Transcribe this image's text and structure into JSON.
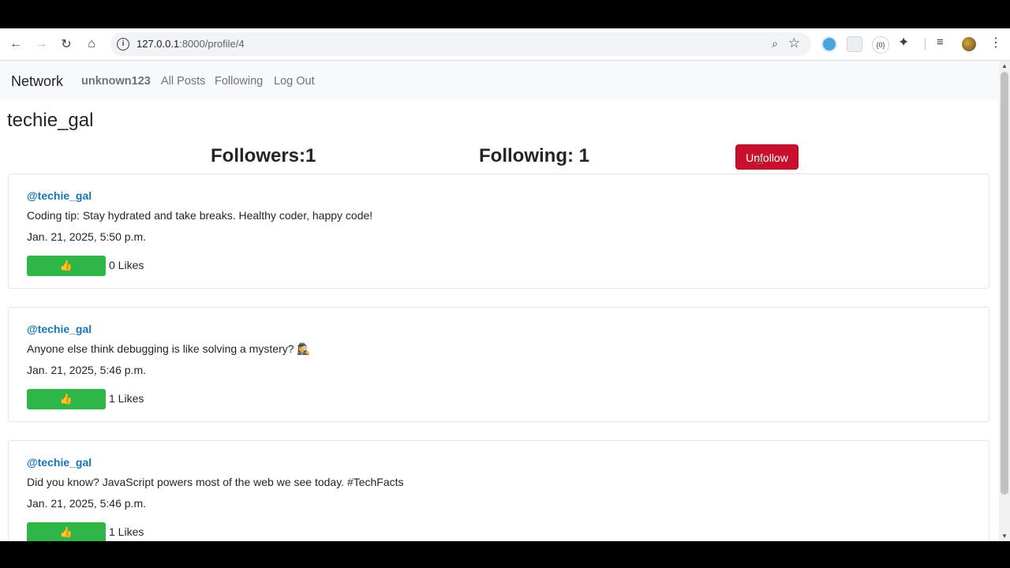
{
  "browser": {
    "url_host": "127.0.0.1",
    "url_path": ":8000/profile/4",
    "icons": {
      "back": "back-arrow-icon",
      "forward": "forward-arrow-icon",
      "reload": "reload-icon",
      "home": "home-icon",
      "info": "site-info-icon",
      "zoom": "zoom-icon",
      "bookmark": "star-icon",
      "extensions": "puzzle-icon",
      "media": "media-control-icon",
      "menu": "kebab-menu-icon"
    },
    "ext_label": "{0}"
  },
  "site_nav": {
    "brand": "Network",
    "user": "unknown123",
    "all_posts": "All Posts",
    "following": "Following",
    "logout": "Log Out"
  },
  "profile": {
    "name": "techie_gal",
    "followers_label": "Followers:1",
    "following_label": "Following: 1",
    "unfollow_label": "Unfollow",
    "unfollow_color": "#c8102e"
  },
  "posts": [
    {
      "author": "@techie_gal",
      "content": "Coding tip: Stay hydrated and take breaks. Healthy coder, happy code!",
      "date": "Jan. 21, 2025, 5:50 p.m.",
      "likes": "0 Likes"
    },
    {
      "author": "@techie_gal",
      "content": "Anyone else think debugging is like solving a mystery? 🕵️‍♀️",
      "date": "Jan. 21, 2025, 5:46 p.m.",
      "likes": "1 Likes"
    },
    {
      "author": "@techie_gal",
      "content": "Did you know? JavaScript powers most of the web we see today. #TechFacts",
      "date": "Jan. 21, 2025, 5:46 p.m.",
      "likes": "1 Likes"
    }
  ],
  "like_button_color": "#2fb548",
  "like_icon": "thumbs-up-icon"
}
